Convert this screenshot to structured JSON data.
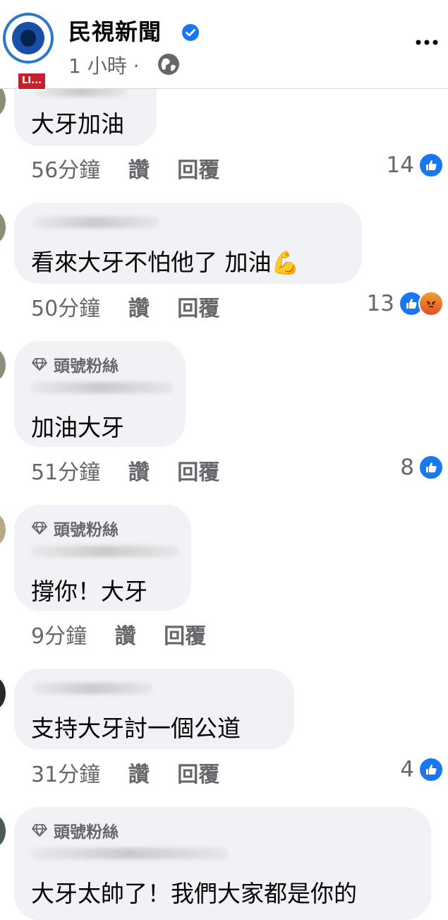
{
  "header": {
    "page_name": "民視新聞",
    "time": "1 小時 ·",
    "live_badge": "LI..."
  },
  "labels": {
    "fan_badge": "頭號粉絲",
    "like": "讚",
    "reply": "回覆"
  },
  "comments": [
    {
      "text": "大牙加油",
      "time": "56分鐘",
      "reactions": "14",
      "emoji": ""
    },
    {
      "text": "看來大牙不怕他了 加油",
      "emoji": "💪",
      "time": "50分鐘",
      "reactions": "13"
    },
    {
      "text": "加油大牙",
      "time": "51分鐘",
      "reactions": "8",
      "emoji": ""
    },
    {
      "text": "撐你！大牙",
      "time": "9分鐘",
      "reactions": "",
      "emoji": ""
    },
    {
      "text": "支持大牙討一個公道",
      "time": "31分鐘",
      "reactions": "4",
      "emoji": ""
    },
    {
      "text": "大牙太帥了！我們大家都是你的",
      "time": "",
      "reactions": "",
      "emoji": ""
    }
  ],
  "colors": {
    "accent": "#1877f2",
    "bubble": "#f0f2f5",
    "meta": "#65676b",
    "live": "#c8202a"
  }
}
